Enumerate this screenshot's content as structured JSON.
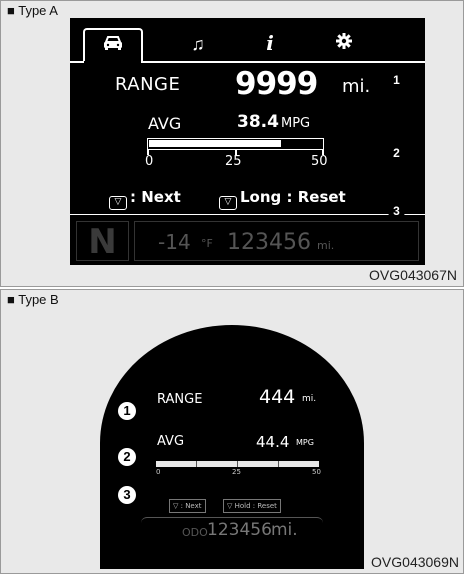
{
  "type_a": {
    "section_label": "■ Type A",
    "tab_icons": [
      "car-icon",
      "music-note-icon",
      "info-icon",
      "gear-icon"
    ],
    "tab_glyphs": [
      "🚘",
      "♫",
      "i",
      "✱"
    ],
    "range": {
      "label": "RANGE",
      "value": "9999",
      "unit": "mi."
    },
    "avg": {
      "label": "AVG",
      "value": "38.4",
      "unit": "MPG",
      "fill_fraction": 0.77
    },
    "gauge_ticks": [
      "0",
      "25",
      "50"
    ],
    "buttons": [
      {
        "icon": "▽",
        "label": ": Next"
      },
      {
        "icon": "▽",
        "label": "Long : Reset"
      }
    ],
    "gear": "N",
    "temperature": {
      "value": "-14",
      "unit": "°F"
    },
    "odometer": {
      "value": "123456",
      "unit": "mi."
    },
    "callouts": [
      "1",
      "2",
      "3"
    ],
    "figure_code": "OVG043067N"
  },
  "type_b": {
    "section_label": "■ Type B",
    "range": {
      "label": "RANGE",
      "value": "444",
      "unit": "mi."
    },
    "avg": {
      "label": "AVG",
      "value": "44.4",
      "unit": "MPG"
    },
    "gauge_ticks": [
      "0",
      "25",
      "50"
    ],
    "buttons": [
      {
        "label": "▽ : Next"
      },
      {
        "label": "▽ Hold : Reset"
      }
    ],
    "odometer": {
      "prefix": "ODO",
      "value": "123456",
      "unit": "mi."
    },
    "callouts": [
      "1",
      "2",
      "3"
    ],
    "figure_code": "OVG043069N"
  },
  "colors": {
    "display_bg": "#000000",
    "panel_bg": "#e9e9e9",
    "text": "#ffffff"
  }
}
